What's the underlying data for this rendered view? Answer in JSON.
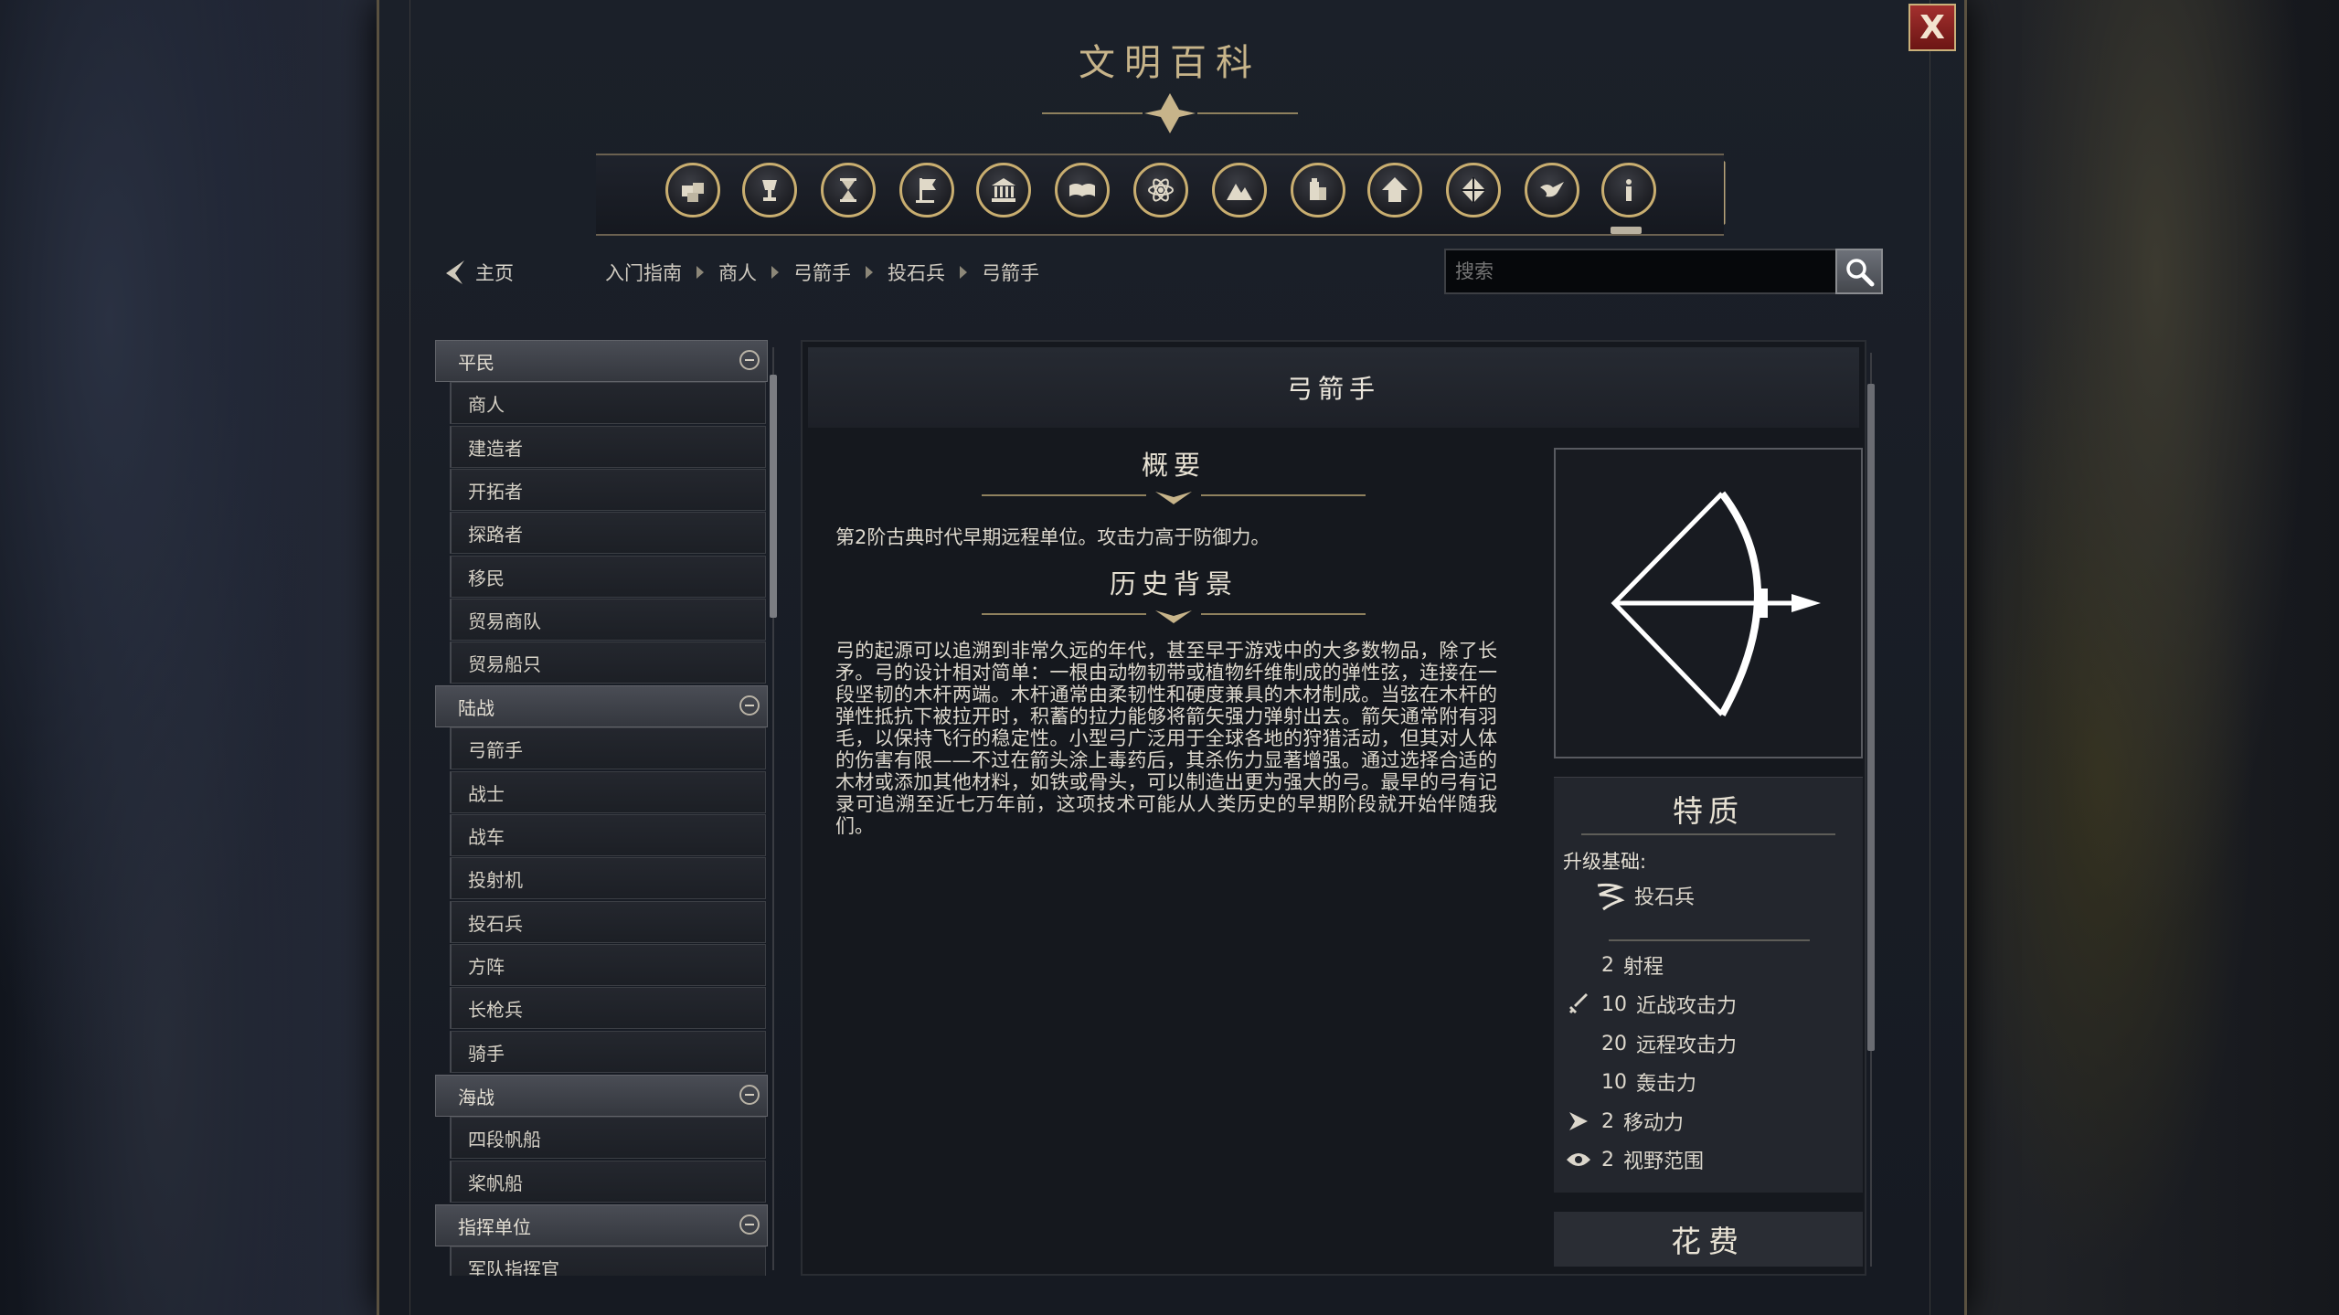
{
  "window": {
    "title": "文明百科",
    "close_label": "X"
  },
  "category_icons": [
    {
      "name": "boxes-icon"
    },
    {
      "name": "goblet-icon"
    },
    {
      "name": "hourglass-icon"
    },
    {
      "name": "flag-icon"
    },
    {
      "name": "temple-icon"
    },
    {
      "name": "book-icon"
    },
    {
      "name": "atom-icon"
    },
    {
      "name": "mountain-icon"
    },
    {
      "name": "district-icon"
    },
    {
      "name": "arrow-up-icon"
    },
    {
      "name": "cube-icon"
    },
    {
      "name": "dove-icon"
    },
    {
      "name": "info-icon"
    }
  ],
  "nav": {
    "home_label": "主页",
    "breadcrumb": [
      "入门指南",
      "商人",
      "弓箭手",
      "投石兵",
      "弓箭手"
    ],
    "search_placeholder": "搜索"
  },
  "sidebar": {
    "categories": [
      {
        "label": "平民",
        "items": [
          "商人",
          "建造者",
          "开拓者",
          "探路者",
          "移民",
          "贸易商队",
          "贸易船只"
        ]
      },
      {
        "label": "陆战",
        "items": [
          "弓箭手",
          "战士",
          "战车",
          "投射机",
          "投石兵",
          "方阵",
          "长枪兵",
          "骑手"
        ]
      },
      {
        "label": "海战",
        "items": [
          "四段帆船",
          "桨帆船"
        ]
      },
      {
        "label": "指挥单位",
        "items": [
          "军队指挥官"
        ]
      }
    ]
  },
  "unit": {
    "name": "弓箭手",
    "overview_title": "概要",
    "overview_text": "第2阶古典时代早期远程单位。攻击力高于防御力。",
    "history_title": "历史背景",
    "history_text": "弓的起源可以追溯到非常久远的年代，甚至早于游戏中的大多数物品，除了长矛。弓的设计相对简单：一根由动物韧带或植物纤维制成的弹性弦，连接在一段坚韧的木杆两端。木杆通常由柔韧性和硬度兼具的木材制成。当弦在木杆的弹性抵抗下被拉开时，积蓄的拉力能够将箭矢强力弹射出去。箭矢通常附有羽毛，以保持飞行的稳定性。小型弓广泛用于全球各地的狩猎活动，但其对人体的伤害有限——不过在箭头涂上毒药后，其杀伤力显著增强。通过选择合适的木材或添加其他材料，如铁或骨头，可以制造出更为强大的弓。最早的弓有记录可追溯至近七万年前，这项技术可能从人类历史的早期阶段就开始伴随我们。",
    "traits_title": "特质",
    "upgrade_label": "升级基础:",
    "upgrade_unit": "投石兵",
    "stats": [
      {
        "icon": "",
        "value": "2",
        "label": "射程"
      },
      {
        "icon": "sword-icon",
        "value": "10",
        "label": "近战攻击力"
      },
      {
        "icon": "",
        "value": "20",
        "label": "远程攻击力"
      },
      {
        "icon": "",
        "value": "10",
        "label": "轰击力"
      },
      {
        "icon": "arrow-icon",
        "value": "2",
        "label": "移动力"
      },
      {
        "icon": "eye-icon",
        "value": "2",
        "label": "视野范围"
      }
    ],
    "cost_title": "花费"
  },
  "colors": {
    "accent_gold": "#c9ae70",
    "title_gold": "#c7b48a",
    "close_red": "#8f2321"
  }
}
